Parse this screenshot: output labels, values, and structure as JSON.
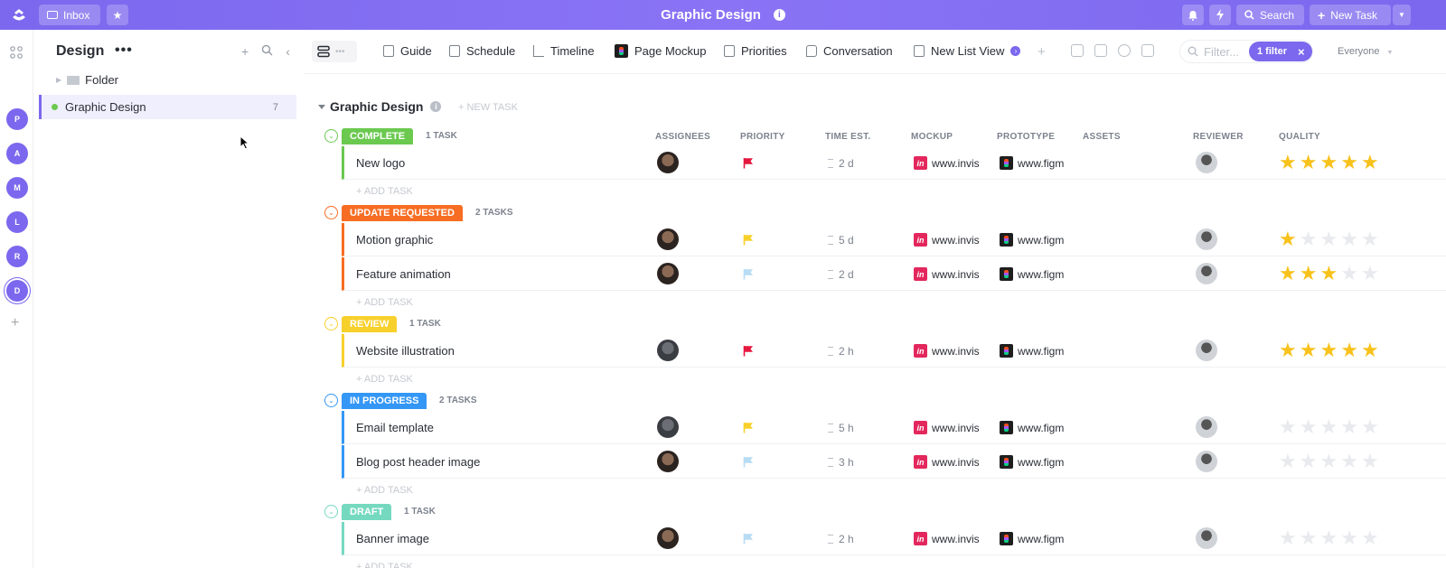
{
  "topbar": {
    "inbox_label": "Inbox",
    "title": "Graphic Design",
    "search_label": "Search",
    "new_task_label": "New Task",
    "accent": "#7b68ee"
  },
  "rail": {
    "spaces": [
      "P",
      "A",
      "M",
      "L",
      "R",
      "D"
    ]
  },
  "sidebar": {
    "title": "Design",
    "folder_label": "Folder",
    "list_label": "Graphic Design",
    "list_count": "7"
  },
  "views": {
    "tabs": [
      "Guide",
      "Schedule",
      "Timeline",
      "Page Mockup",
      "Priorities",
      "Conversation",
      "New List View"
    ],
    "filter_placeholder": "Filter...",
    "filter_pill": "1 filter",
    "everyone": "Everyone"
  },
  "list": {
    "title": "Graphic Design",
    "new_task": "+ NEW TASK",
    "add_task": "+ ADD TASK",
    "columns": [
      "ASSIGNEES",
      "PRIORITY",
      "TIME EST.",
      "MOCKUP",
      "PROTOTYPE",
      "ASSETS",
      "REVIEWER",
      "QUALITY"
    ]
  },
  "groups": [
    {
      "status": "COMPLETE",
      "count": "1 TASK",
      "color": "#6bc950",
      "tasks": [
        {
          "name": "New logo",
          "flag": "#e5173f",
          "time": "2 d",
          "mockup": "www.invis",
          "prototype": "www.figm",
          "quality": 5,
          "assignee": "f"
        }
      ]
    },
    {
      "status": "UPDATE REQUESTED",
      "count": "2 TASKS",
      "color": "#f76d24",
      "tasks": [
        {
          "name": "Motion graphic",
          "flag": "#f8d02c",
          "time": "5 d",
          "mockup": "www.invis",
          "prototype": "www.figm",
          "quality": 1,
          "assignee": "f"
        },
        {
          "name": "Feature animation",
          "flag": "#b7dcf4",
          "time": "2 d",
          "mockup": "www.invis",
          "prototype": "www.figm",
          "quality": 3,
          "assignee": "f"
        }
      ]
    },
    {
      "status": "REVIEW",
      "count": "1 TASK",
      "color": "#f8d02c",
      "tasks": [
        {
          "name": "Website illustration",
          "flag": "#e5173f",
          "time": "2 h",
          "mockup": "www.invis",
          "prototype": "www.figm",
          "quality": 5,
          "assignee": "m"
        }
      ]
    },
    {
      "status": "IN PROGRESS",
      "count": "2 TASKS",
      "color": "#3497f5",
      "tasks": [
        {
          "name": "Email template",
          "flag": "#f8d02c",
          "time": "5 h",
          "mockup": "www.invis",
          "prototype": "www.figm",
          "quality": 0,
          "assignee": "m"
        },
        {
          "name": "Blog post header image",
          "flag": "#b7dcf4",
          "time": "3 h",
          "mockup": "www.invis",
          "prototype": "www.figm",
          "quality": 0,
          "assignee": "f"
        }
      ]
    },
    {
      "status": "DRAFT",
      "count": "1 TASK",
      "color": "#75d9c0",
      "tasks": [
        {
          "name": "Banner image",
          "flag": "#b7dcf4",
          "time": "2 h",
          "mockup": "www.invis",
          "prototype": "www.figm",
          "quality": 0,
          "assignee": "f"
        }
      ]
    }
  ]
}
